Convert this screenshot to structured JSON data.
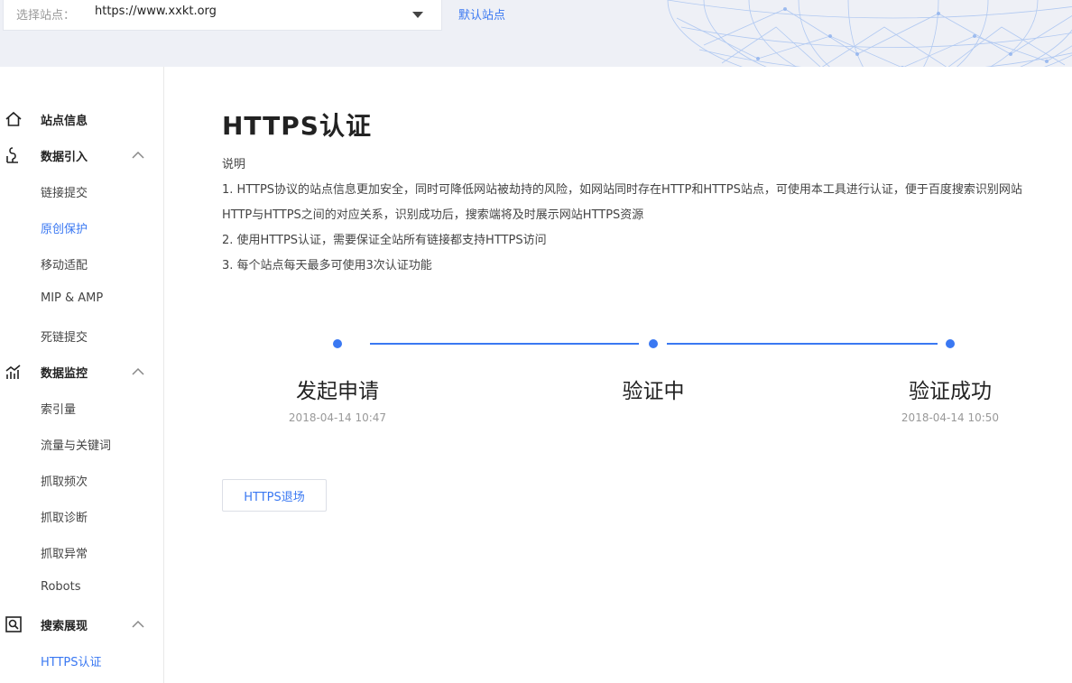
{
  "header": {
    "site_label": "选择站点：",
    "site_value": "https://www.xxkt.org",
    "default_site": "默认站点"
  },
  "sidebar": {
    "groups": [
      {
        "label": "站点信息",
        "icon": "home-icon",
        "items": []
      },
      {
        "label": "数据引入",
        "icon": "data-import-icon",
        "expanded": true,
        "items": [
          "链接提交",
          "原创保护",
          "移动适配",
          "MIP & AMP",
          "死链提交"
        ]
      },
      {
        "label": "数据监控",
        "icon": "data-monitor-icon",
        "expanded": true,
        "items": [
          "索引量",
          "流量与关键词",
          "抓取频次",
          "抓取诊断",
          "抓取异常",
          "Robots"
        ]
      },
      {
        "label": "搜索展现",
        "icon": "search-display-icon",
        "expanded": true,
        "items": [
          "HTTPS认证"
        ]
      }
    ],
    "active_items": [
      "原创保护",
      "HTTPS认证"
    ]
  },
  "main": {
    "title": "HTTPS认证",
    "description": {
      "heading": "说明",
      "lines": [
        "1. HTTPS协议的站点信息更加安全，同时可降低网站被劫持的风险，如网站同时存在HTTP和HTTPS站点，可使用本工具进行认证，便于百度搜索识别网站",
        "HTTP与HTTPS之间的对应关系，识别成功后，搜索端将及时展示网站HTTPS资源",
        "2. 使用HTTPS认证，需要保证全站所有链接都支持HTTPS访问",
        "3. 每个站点每天最多可使用3次认证功能"
      ]
    },
    "steps": [
      {
        "title": "发起申请",
        "time": "2018-04-14 10:47"
      },
      {
        "title": "验证中",
        "time": ""
      },
      {
        "title": "验证成功",
        "time": "2018-04-14 10:50"
      }
    ],
    "exit_button": "HTTPS退场"
  },
  "colors": {
    "accent": "#3a78f2",
    "header_bg": "#eef0f6"
  }
}
